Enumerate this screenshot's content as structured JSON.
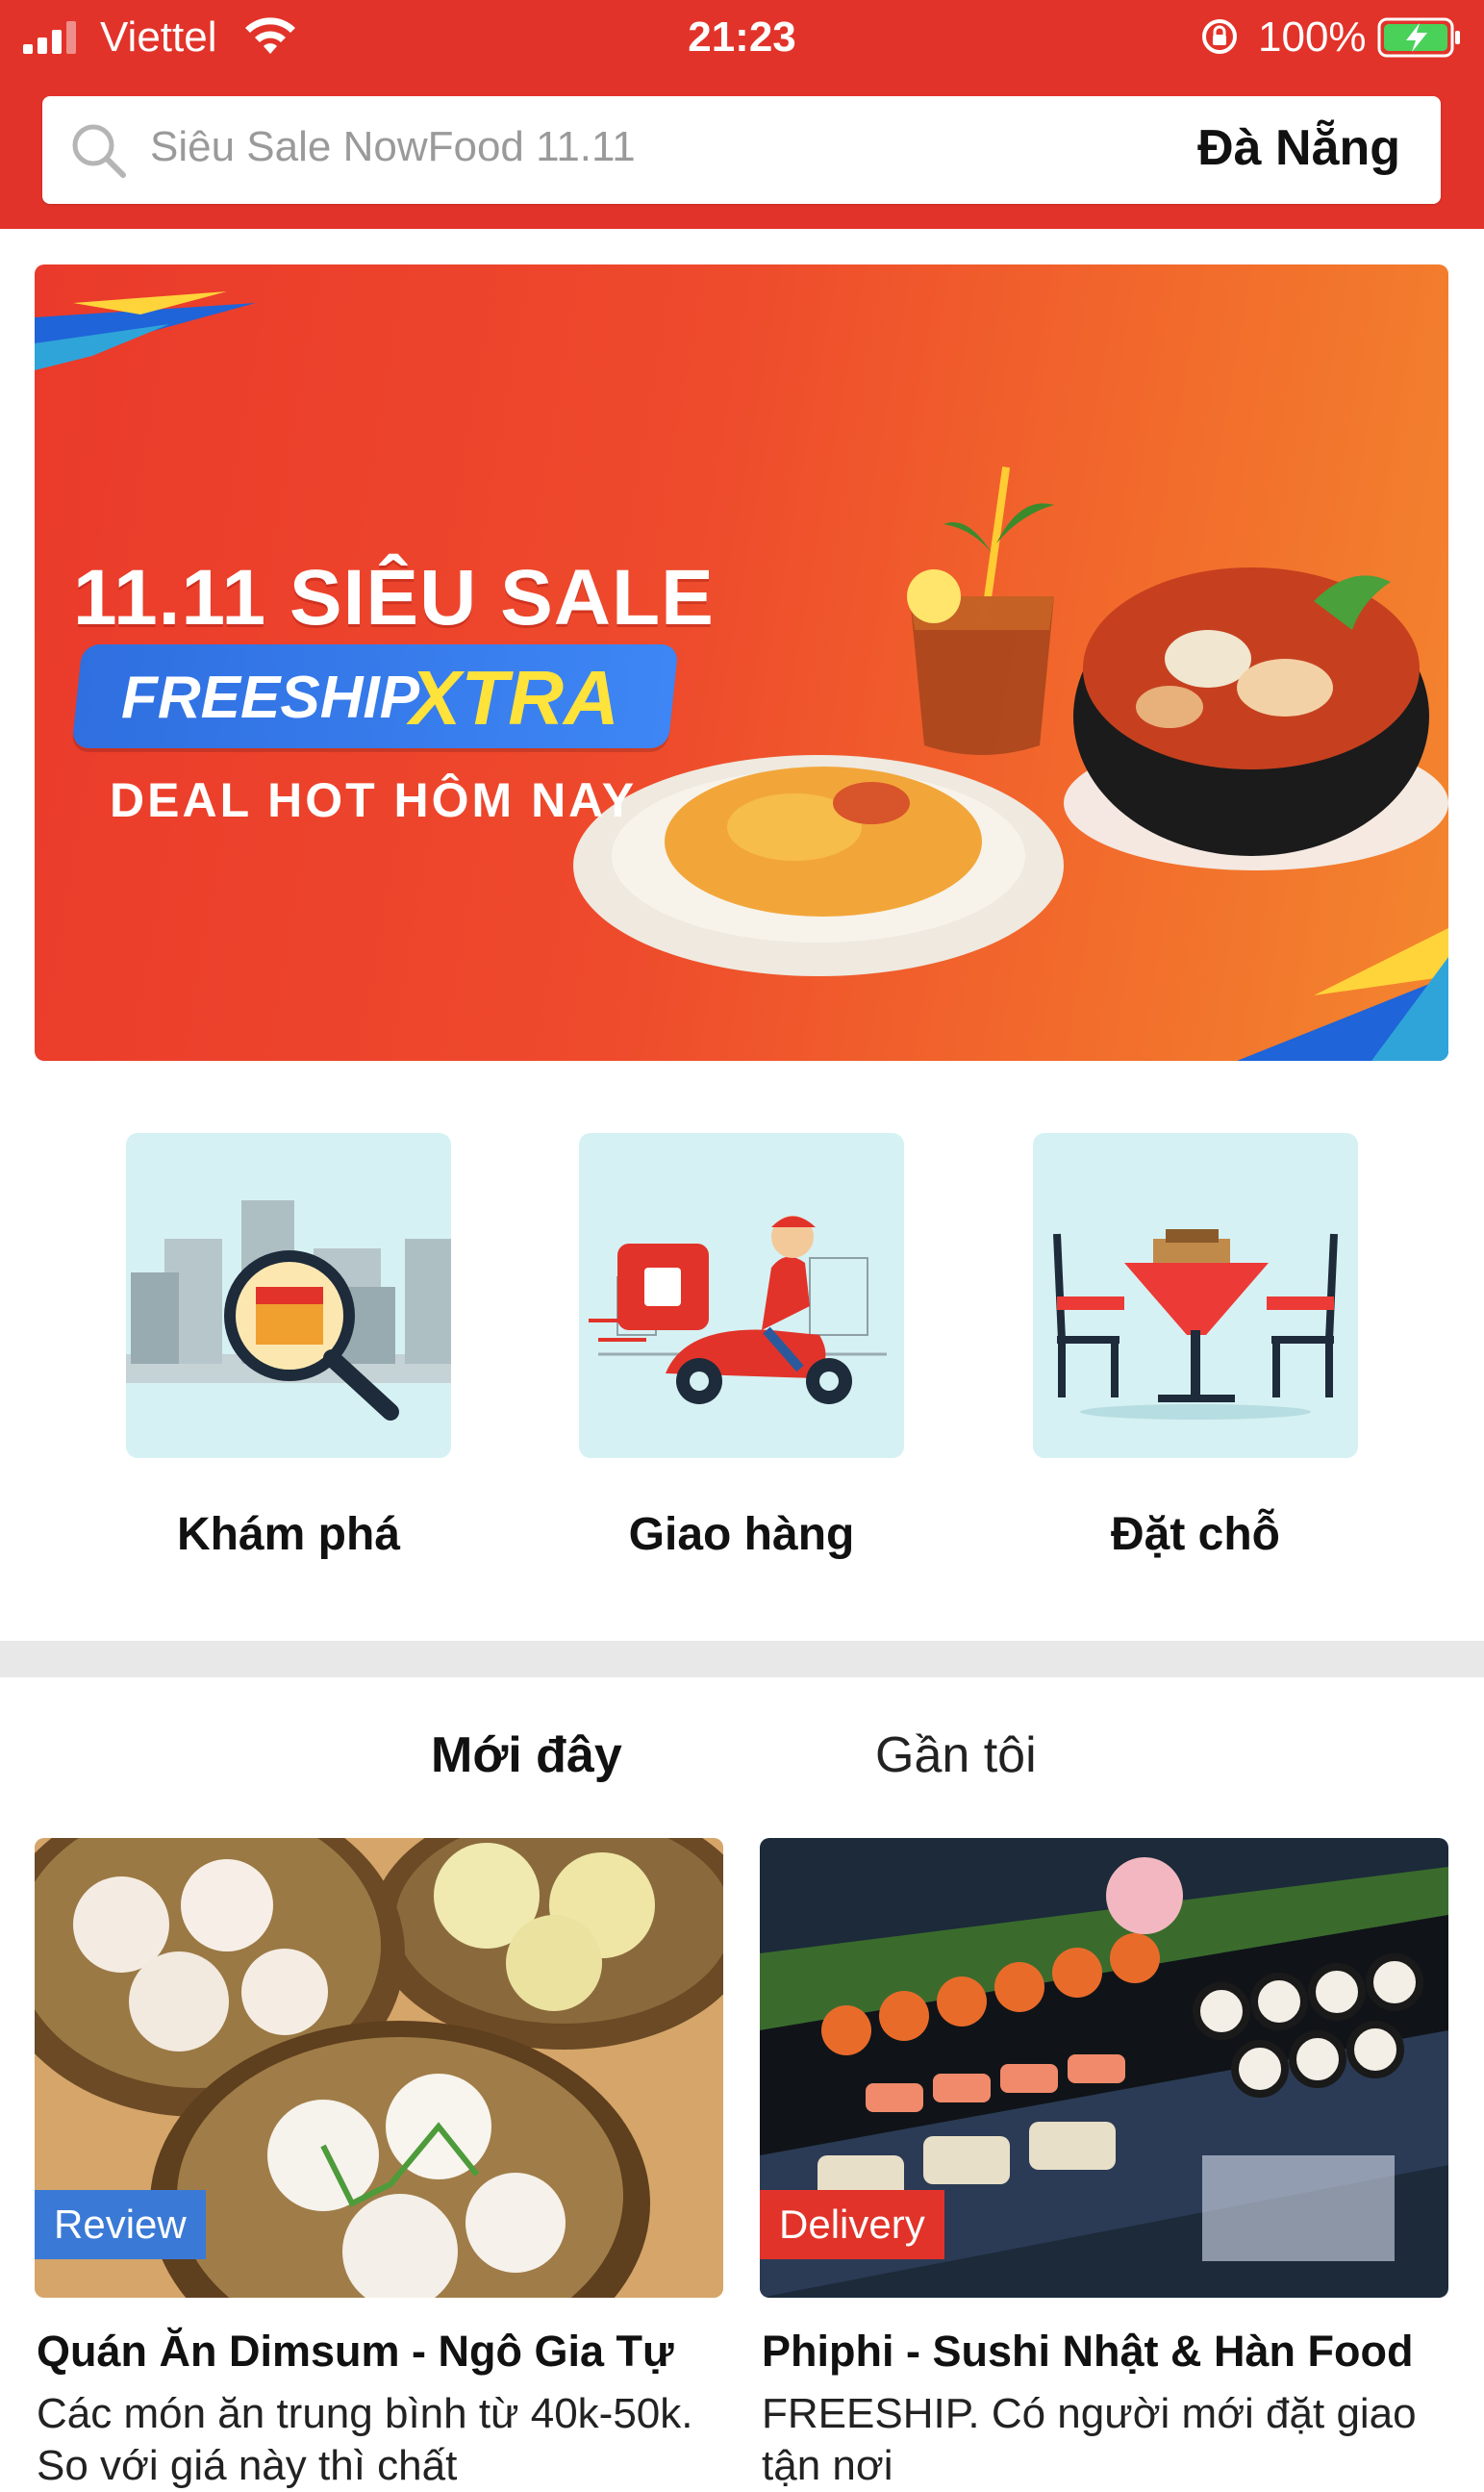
{
  "status_bar": {
    "carrier": "Viettel",
    "time": "21:23",
    "battery": "100%"
  },
  "search": {
    "placeholder": "Siêu Sale NowFood 11.11",
    "city": "Đà Nẵng"
  },
  "banner": {
    "title": "11.11 SIÊU SALE",
    "freeship": "FREESHIP",
    "xtra": "XTRA",
    "subtitle": "DEAL HOT HÔM NAY"
  },
  "categories": [
    {
      "label": "Khám phá",
      "icon": "explore-magnifier-icon"
    },
    {
      "label": "Giao hàng",
      "icon": "delivery-scooter-icon"
    },
    {
      "label": "Đặt chỗ",
      "icon": "reservation-table-icon"
    }
  ],
  "tabs": [
    {
      "label": "Mới đây",
      "active": true
    },
    {
      "label": "Gần tôi",
      "active": false
    }
  ],
  "cards": [
    {
      "badge": "Review",
      "title": "Quán Ăn Dimsum - Ngô Gia Tự",
      "desc": "Các món ăn trung bình từ 40k-50k. So với giá này thì chất"
    },
    {
      "badge": "Delivery",
      "title": "Phiphi - Sushi Nhật & Hàn Food",
      "desc": "FREESHIP. Có người mới đặt giao tận nơi"
    }
  ],
  "colors": {
    "brand_red": "#e2332a",
    "review_badge": "#3a7ad6",
    "tile_bg": "#d6f1f3"
  }
}
